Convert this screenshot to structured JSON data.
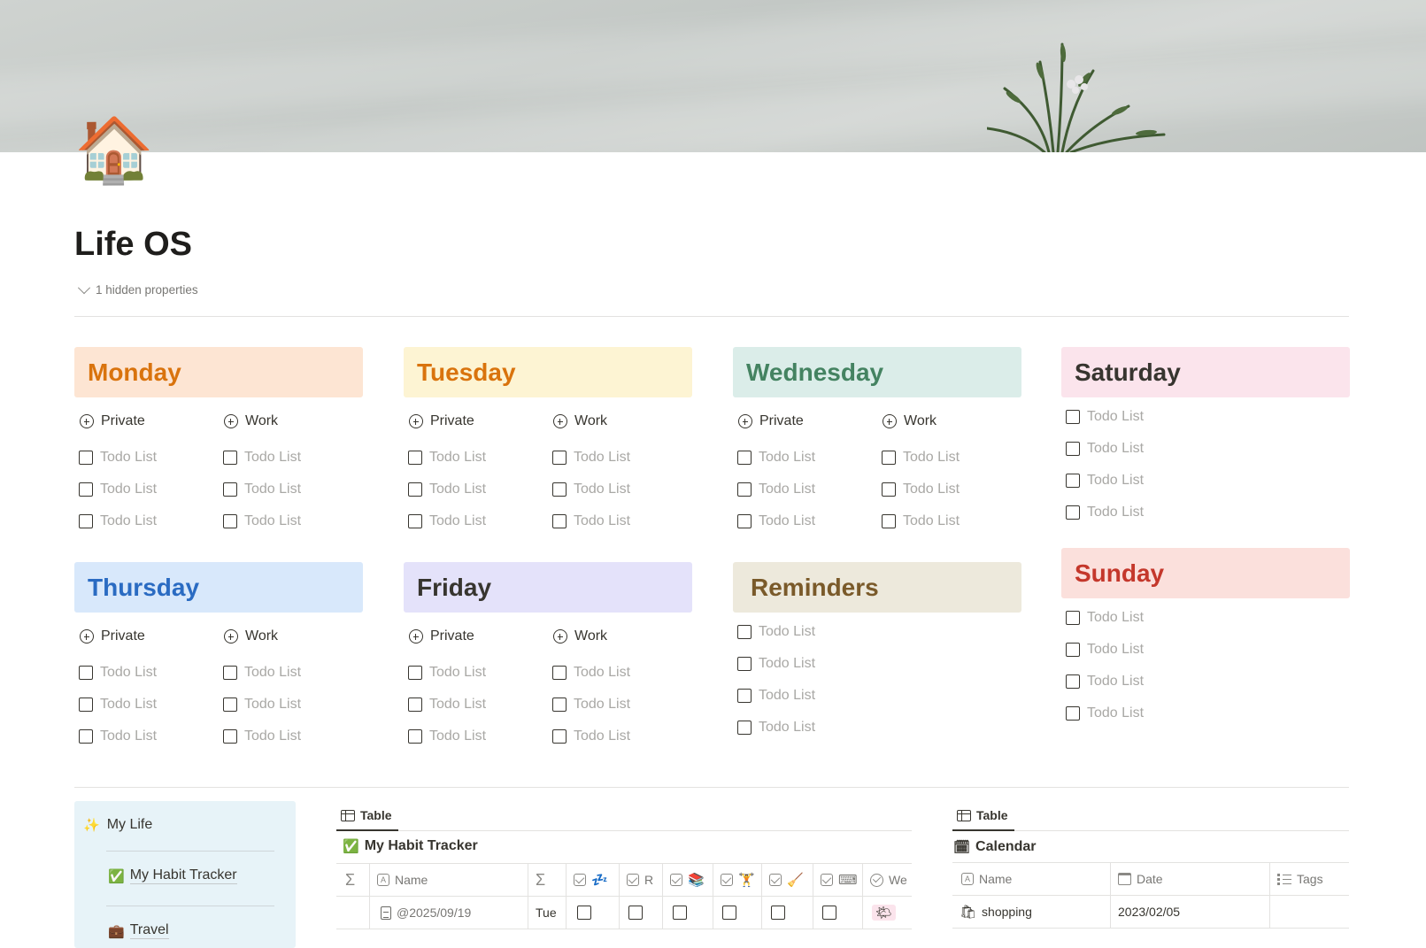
{
  "page": {
    "icon": "🏠",
    "title": "Life OS",
    "hidden_properties": "1 hidden properties"
  },
  "days": {
    "monday": {
      "title": "Monday",
      "bg": "#fde5d3",
      "color": "#d9730d",
      "private": "Private",
      "work": "Work",
      "private_items": [
        "Todo List",
        "Todo List",
        "Todo List"
      ],
      "work_items": [
        "Todo List",
        "Todo List",
        "Todo List"
      ]
    },
    "tuesday": {
      "title": "Tuesday",
      "bg": "#fdf4d3",
      "color": "#d9730d",
      "private": "Private",
      "work": "Work",
      "private_items": [
        "Todo List",
        "Todo List",
        "Todo List"
      ],
      "work_items": [
        "Todo List",
        "Todo List",
        "Todo List"
      ]
    },
    "wednesday": {
      "title": "Wednesday",
      "bg": "#dbede9",
      "color": "#448361",
      "private": "Private",
      "work": "Work",
      "private_items": [
        "Todo List",
        "Todo List",
        "Todo List"
      ],
      "work_items": [
        "Todo List",
        "Todo List",
        "Todo List"
      ]
    },
    "thursday": {
      "title": "Thursday",
      "bg": "#d8e8fb",
      "color": "#2a6bc2",
      "private": "Private",
      "work": "Work",
      "private_items": [
        "Todo List",
        "Todo List",
        "Todo List"
      ],
      "work_items": [
        "Todo List",
        "Todo List",
        "Todo List"
      ]
    },
    "friday": {
      "title": "Friday",
      "bg": "#e4e2fa",
      "color": "#37352f",
      "private": "Private",
      "work": "Work",
      "private_items": [
        "Todo List",
        "Todo List",
        "Todo List"
      ],
      "work_items": [
        "Todo List",
        "Todo List",
        "Todo List"
      ]
    },
    "saturday": {
      "title": "Saturday",
      "bg": "#fbe4ec",
      "color": "#37352f",
      "items": [
        "Todo List",
        "Todo List",
        "Todo List",
        "Todo List"
      ]
    },
    "sunday": {
      "title": "Sunday",
      "bg": "#fbe0dc",
      "color": "#c4372b",
      "items": [
        "Todo List",
        "Todo List",
        "Todo List",
        "Todo List"
      ]
    },
    "reminders": {
      "title": "Reminders",
      "bg": "#ede9dc",
      "color": "#7a5a2a",
      "items": [
        "Todo List",
        "Todo List",
        "Todo List",
        "Todo List"
      ]
    }
  },
  "my_life": {
    "icon": "✨",
    "title": "My Life",
    "items": [
      {
        "icon": "✅",
        "label": "My Habit Tracker"
      },
      {
        "icon": "💼",
        "label": "Travel"
      }
    ]
  },
  "habit_table": {
    "view_label": "Table",
    "title": "My Habit Tracker",
    "title_icon": "✅",
    "headers": [
      "Name",
      "R",
      "We"
    ],
    "header_emojis": [
      "💤",
      "📚",
      "🏋",
      "🧹",
      "⌨"
    ],
    "row": {
      "name": "@2025/09/19",
      "day": "Tue",
      "mood": "🌤"
    }
  },
  "calendar_table": {
    "view_label": "Table",
    "title": "Calendar",
    "title_icon": "🗓",
    "headers": [
      "Name",
      "Date",
      "Tags"
    ],
    "row": {
      "icon": "🛍",
      "name": "shopping",
      "date": "2023/02/05"
    }
  }
}
